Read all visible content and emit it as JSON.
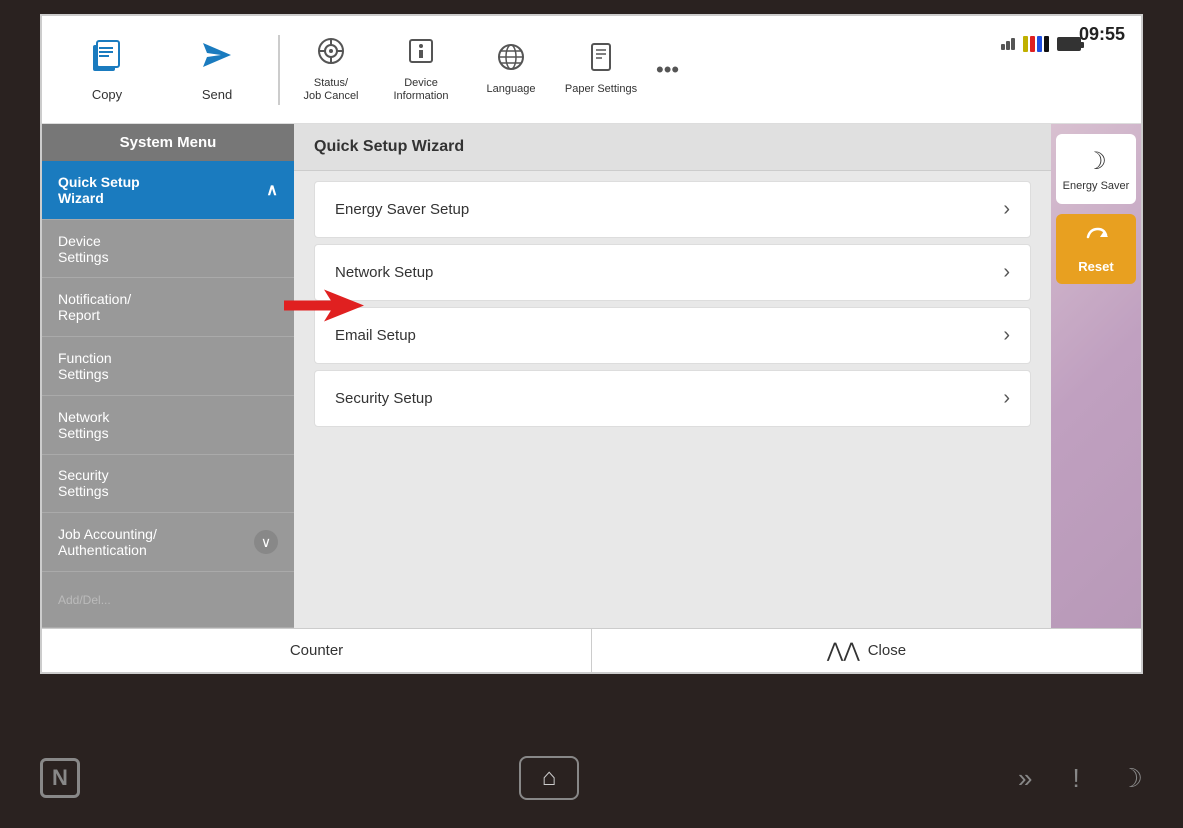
{
  "time": "09:55",
  "top_nav": {
    "items": [
      {
        "id": "copy",
        "label": "Copy",
        "icon": "📄"
      },
      {
        "id": "send",
        "label": "Send",
        "icon": "✈"
      }
    ],
    "secondary_items": [
      {
        "id": "status",
        "label": "Status/\nJob Cancel",
        "icon": "◎"
      },
      {
        "id": "device_info",
        "label": "Device\nInformation",
        "icon": "ℹ"
      },
      {
        "id": "language",
        "label": "Language",
        "icon": "🌐"
      },
      {
        "id": "paper_settings",
        "label": "Paper Settings",
        "icon": "📋"
      }
    ],
    "more": "•••"
  },
  "sidebar": {
    "title": "System Menu",
    "items": [
      {
        "id": "quick-setup",
        "label": "Quick Setup Wizard",
        "active": true,
        "has_arrow": true
      },
      {
        "id": "device-settings",
        "label": "Device Settings",
        "active": false,
        "has_arrow": false
      },
      {
        "id": "notification-report",
        "label": "Notification/\nReport",
        "active": false,
        "has_arrow": false,
        "has_annotation": true
      },
      {
        "id": "function-settings",
        "label": "Function Settings",
        "active": false,
        "has_arrow": false
      },
      {
        "id": "network-settings",
        "label": "Network Settings",
        "active": false,
        "has_arrow": false
      },
      {
        "id": "security-settings",
        "label": "Security Settings",
        "active": false,
        "has_arrow": false
      },
      {
        "id": "job-accounting",
        "label": "Job Accounting/\nAuthentication",
        "active": false,
        "has_arrow": true
      }
    ]
  },
  "content": {
    "header": "Quick Setup Wizard",
    "items": [
      {
        "id": "energy-saver",
        "label": "Energy Saver Setup"
      },
      {
        "id": "network",
        "label": "Network Setup"
      },
      {
        "id": "email",
        "label": "Email Setup"
      },
      {
        "id": "security",
        "label": "Security Setup"
      }
    ]
  },
  "right_panel": {
    "energy_saver_label": "Energy Saver",
    "reset_label": "Reset"
  },
  "bottom_bar": {
    "counter_label": "Counter",
    "close_label": "Close"
  },
  "physical_bar": {
    "nfc_icon": "N",
    "home_icon": "⌂",
    "forward_icon": "»",
    "alert_icon": "!",
    "moon_icon": "☽"
  }
}
